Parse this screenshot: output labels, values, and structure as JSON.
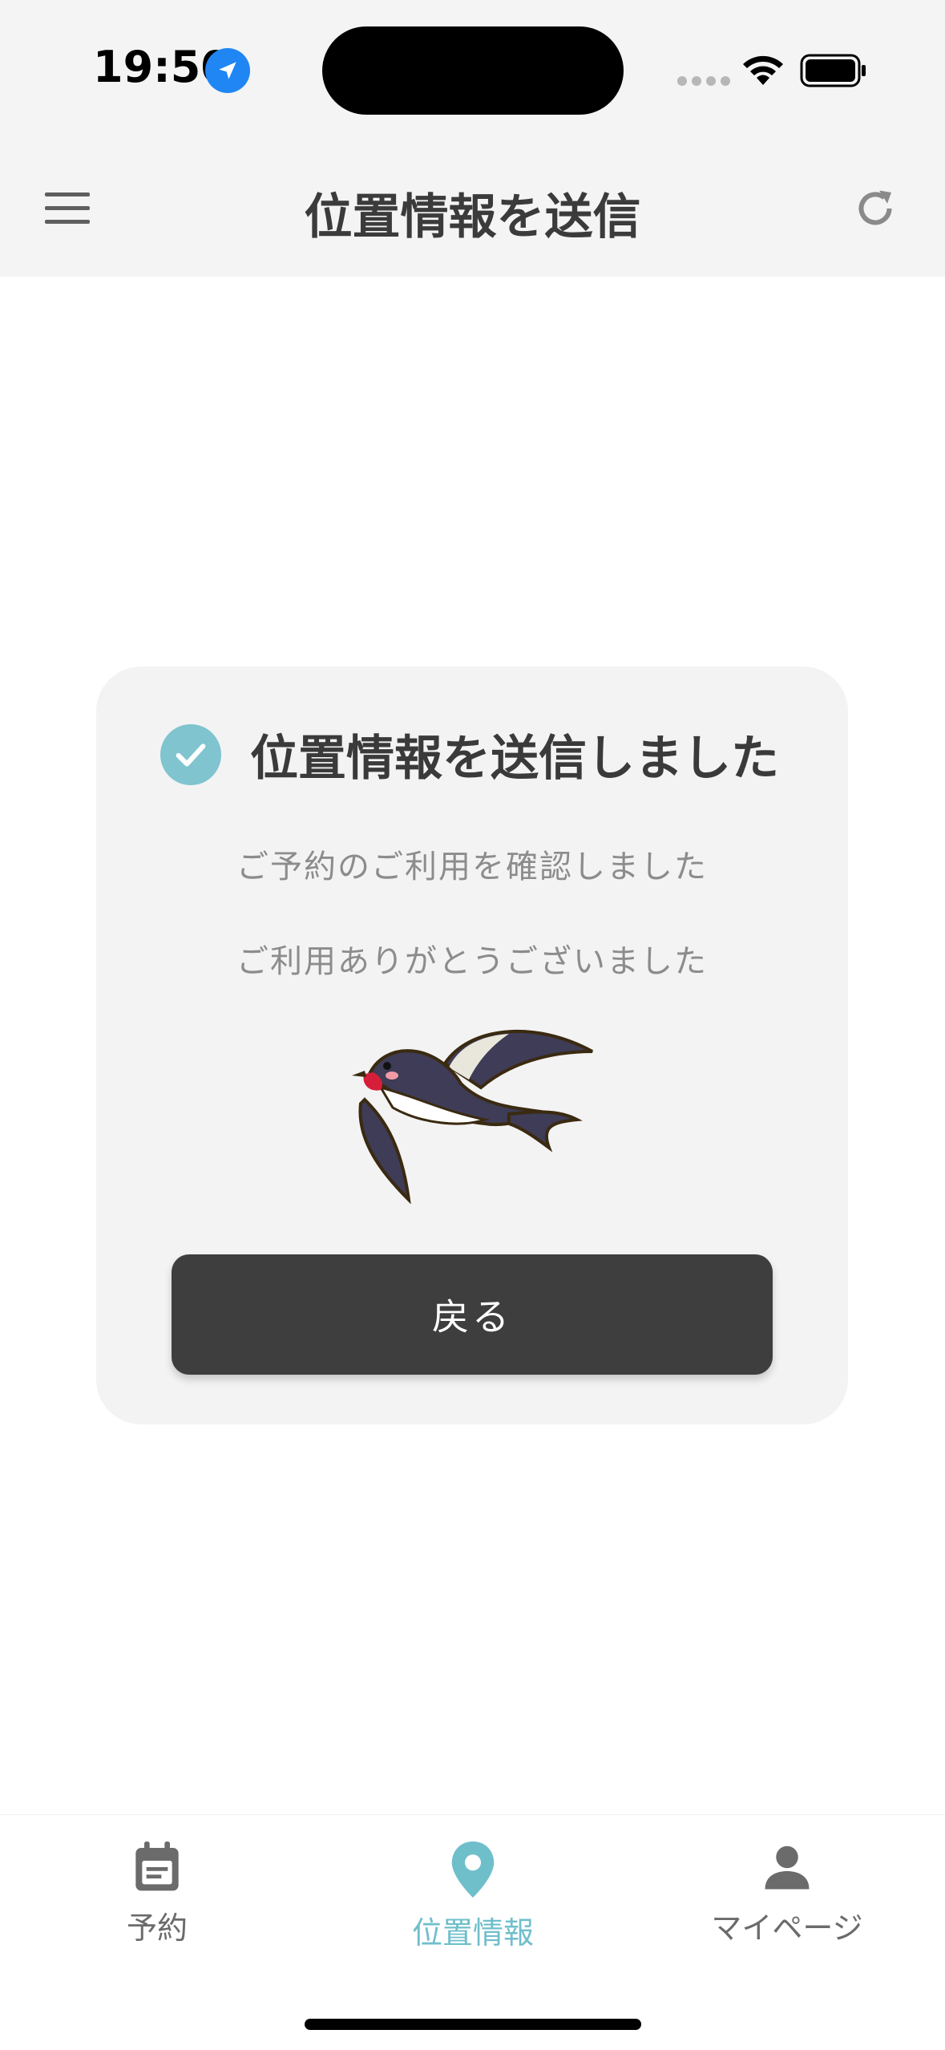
{
  "status_bar": {
    "time": "19:50",
    "icons": [
      "location-arrow-icon",
      "cellular-signal-icon",
      "wifi-icon",
      "battery-icon"
    ]
  },
  "app_bar": {
    "title": "位置情報を送信",
    "left_icon": "menu-icon",
    "right_icon": "refresh-icon"
  },
  "card": {
    "title": "位置情報を送信しました",
    "message1": "ご予約のご利用を確認しました",
    "message2": "ご利用ありがとうございました",
    "image": "swallow-bird",
    "back_button": "戻る"
  },
  "bottom_nav": {
    "items": [
      {
        "label": "予約",
        "icon": "calendar-icon",
        "active": false
      },
      {
        "label": "位置情報",
        "icon": "location-pin-icon",
        "active": true
      },
      {
        "label": "マイページ",
        "icon": "person-icon",
        "active": false
      }
    ]
  },
  "colors": {
    "accent": "#6fbfcb",
    "header_bg": "#f4f4f4",
    "card_bg": "#f3f3f3",
    "button_bg": "#3e3e3e",
    "inactive": "#6b6b6b"
  }
}
